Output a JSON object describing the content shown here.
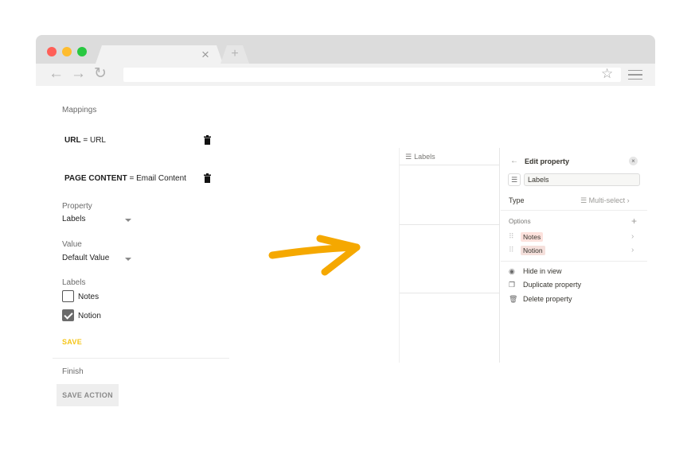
{
  "browser": {
    "tab_close": "×",
    "tab_new": "+",
    "back": "←",
    "forward": "→",
    "reload": "↻",
    "bookmark": "☆",
    "url": ""
  },
  "left_panel": {
    "mappings_label": "Mappings",
    "mappings": [
      {
        "key": "URL",
        "eq": " = ",
        "value": "URL"
      },
      {
        "key": "PAGE CONTENT",
        "eq": " = ",
        "value": "Email Content"
      }
    ],
    "property_label": "Property",
    "property_value": "Labels",
    "value_label": "Value",
    "value_value": "Default Value",
    "labels_label": "Labels",
    "checkboxes": [
      {
        "label": "Notes",
        "checked": false
      },
      {
        "label": "Notion",
        "checked": true
      }
    ],
    "save_label": "SAVE",
    "finish_label": "Finish",
    "save_action_label": "SAVE ACTION"
  },
  "notion": {
    "column_icon": "☰",
    "column_header": "Labels",
    "edit_property": {
      "back": "←",
      "title": "Edit property",
      "close": "×",
      "name_icon": "☰",
      "name_value": "Labels",
      "type_label": "Type",
      "type_value": "☰ Multi-select ›",
      "options_label": "Options",
      "add_option": "+",
      "options": [
        {
          "label": "Notes",
          "color": "#fde2dd"
        },
        {
          "label": "Notion",
          "color": "#f5e0dc"
        }
      ],
      "grip": "⠿",
      "chevron": "›",
      "actions": [
        {
          "icon": "◉",
          "label": "Hide in view"
        },
        {
          "icon": "❐",
          "label": "Duplicate property"
        },
        {
          "icon": "🗑",
          "label": "Delete property"
        }
      ]
    }
  },
  "colors": {
    "accent_save": "#f5c518",
    "arrow": "#f5a800"
  }
}
